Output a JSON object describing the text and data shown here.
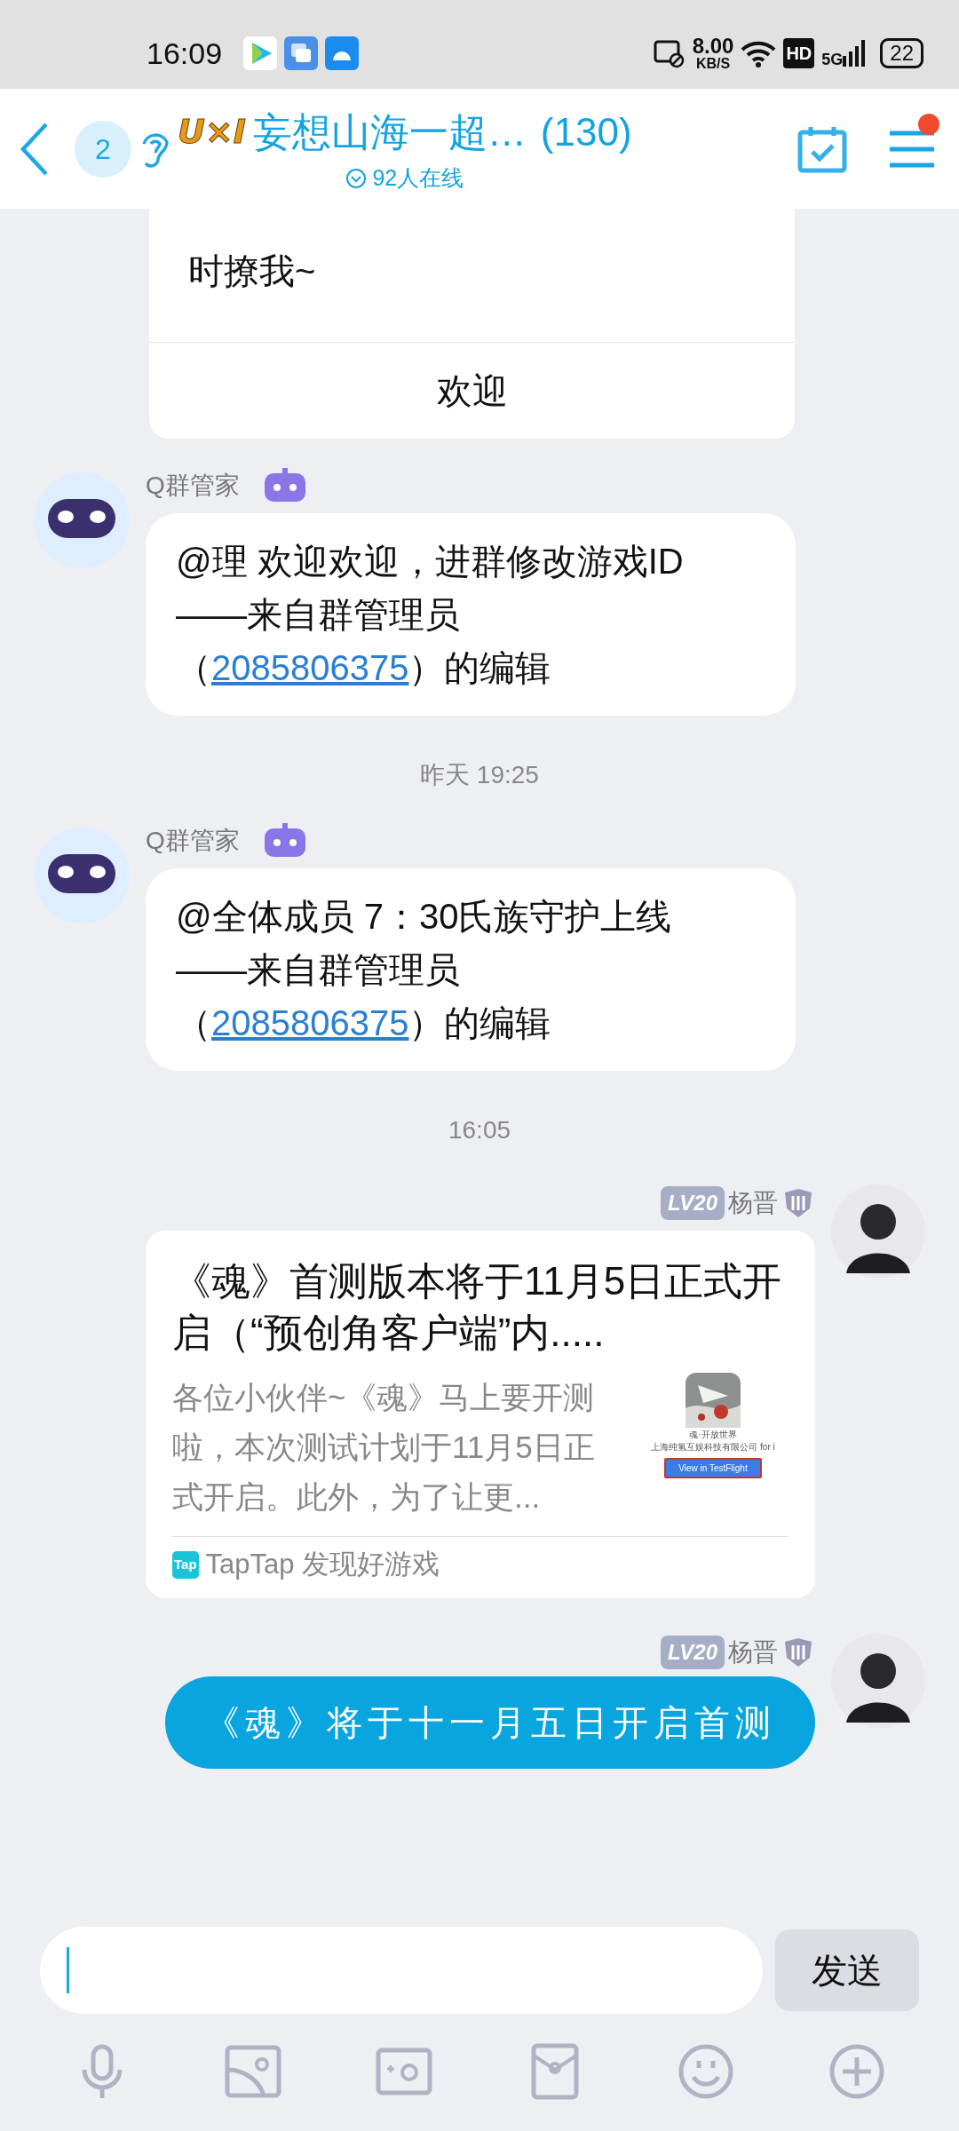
{
  "status_bar": {
    "time": "16:09",
    "speed": "8.00",
    "speed_unit": "KB/S",
    "hd": "HD",
    "network": "5G",
    "battery": "22"
  },
  "header": {
    "unread_count": "2",
    "group_logo": "U×I",
    "title": "妄想山海一超…",
    "member_count": "(130)",
    "online": "92人在线",
    "menu_has_dot": true
  },
  "messages": [
    {
      "kind": "card_tail",
      "text": "时撩我~",
      "action": "欢迎"
    },
    {
      "kind": "text",
      "sender": "Q群管家",
      "lines": [
        "@理 欢迎欢迎，进群修改游戏ID",
        "——来自群管理员",
        "（"
      ],
      "link": "2085806375",
      "text_after": "）的编辑"
    },
    {
      "kind": "time",
      "text": "昨天 19:25"
    },
    {
      "kind": "text",
      "sender": "Q群管家",
      "lines": [
        "@全体成员 7：30氏族守护上线",
        "——来自群管理员",
        "（"
      ],
      "link": "2085806375",
      "text_after": "）的编辑"
    },
    {
      "kind": "time",
      "text": "16:05"
    },
    {
      "kind": "link_card",
      "sender": "杨晋",
      "level_badge": "LV20",
      "title": "《魂》首测版本将于11月5日正式开启（“预创角客户端”内.....",
      "summary": "各位小伙伴~《魂》马上要开测啦，本次测试计划于11月5日正式开启。此外，为了让更...",
      "thumbnail": {
        "app_name": "魂·开放世界",
        "developer": "上海纯氢互娱科技有限公司 for i",
        "button": "View in TestFlight"
      },
      "source_logo": "Tap",
      "source": "TapTap 发现好游戏"
    },
    {
      "kind": "bubble",
      "sender": "杨晋",
      "level_badge": "LV20",
      "text": "《魂》将于十一月五日开启首测"
    }
  ],
  "input": {
    "focused": true
  },
  "send_button": "发送"
}
